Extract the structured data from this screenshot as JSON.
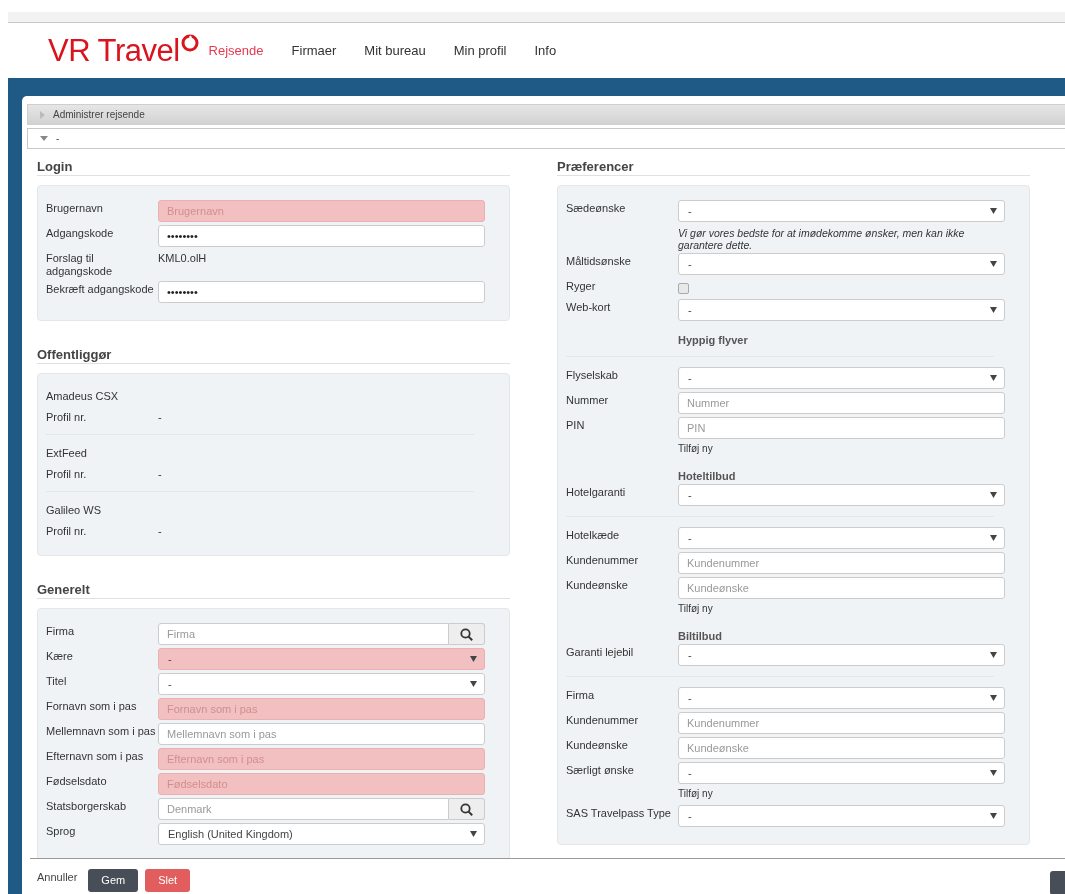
{
  "header": {
    "logo": "VR Travel",
    "nav": [
      {
        "label": "Rejsende",
        "selected": true
      },
      {
        "label": "Firmaer",
        "selected": false
      },
      {
        "label": "Mit bureau",
        "selected": false
      },
      {
        "label": "Min profil",
        "selected": false
      },
      {
        "label": "Info",
        "selected": false
      }
    ]
  },
  "panels": [
    {
      "label": "Administrer rejsende",
      "expanded": false
    },
    {
      "label": "-",
      "expanded": true
    }
  ],
  "columns": [
    [
      {
        "title": "Login",
        "rows": [
          {
            "kind": "input",
            "label": "Brugernavn",
            "placeholder": "Brugernavn",
            "invalid": true
          },
          {
            "kind": "input",
            "label": "Adgangskode",
            "value": "••••••••",
            "invalid": false
          },
          {
            "kind": "text",
            "label": "Forslag til adgangskode",
            "value": "KML0.olH"
          },
          {
            "kind": "input",
            "label": "Bekræft adgangskode",
            "value": "••••••••",
            "invalid": false
          }
        ]
      },
      {
        "title": "Offentliggør",
        "rows": [
          {
            "kind": "name",
            "label": "Amadeus CSX"
          },
          {
            "kind": "text",
            "label": "Profil nr.",
            "value": "-"
          },
          {
            "kind": "divider"
          },
          {
            "kind": "name",
            "label": "ExtFeed"
          },
          {
            "kind": "text",
            "label": "Profil nr.",
            "value": "-"
          },
          {
            "kind": "divider"
          },
          {
            "kind": "name",
            "label": "Galileo WS"
          },
          {
            "kind": "text",
            "label": "Profil nr.",
            "value": "-"
          }
        ]
      },
      {
        "title": "Generelt",
        "rows": [
          {
            "kind": "search",
            "label": "Firma",
            "placeholder": "Firma",
            "invalid": false
          },
          {
            "kind": "select",
            "label": "Kære",
            "value": "-",
            "invalid": true
          },
          {
            "kind": "select",
            "label": "Titel",
            "value": "-",
            "invalid": false
          },
          {
            "kind": "input",
            "label": "Fornavn som i pas",
            "placeholder": "Fornavn som i pas",
            "invalid": true
          },
          {
            "kind": "input",
            "label": "Mellemnavn som i pas",
            "placeholder": "Mellemnavn som i pas",
            "invalid": false
          },
          {
            "kind": "input",
            "label": "Efternavn som i pas",
            "placeholder": "Efternavn som i pas",
            "invalid": true
          },
          {
            "kind": "input",
            "label": "Fødselsdato",
            "placeholder": "Fødselsdato",
            "invalid": true
          },
          {
            "kind": "search",
            "label": "Statsborgerskab",
            "placeholder": "Denmark",
            "invalid": false
          },
          {
            "kind": "select",
            "label": "Sprog",
            "value": "English (United Kingdom)",
            "invalid": false
          }
        ]
      }
    ],
    [
      {
        "title": "Præferencer",
        "rows": [
          {
            "kind": "select",
            "label": "Sædeønske",
            "value": "-",
            "invalid": false
          },
          {
            "kind": "note",
            "value": "Vi gør vores bedste for at imødekomme ønsker, men kan ikke garantere dette."
          },
          {
            "kind": "select",
            "label": "Måltidsønske",
            "value": "-",
            "invalid": false
          },
          {
            "kind": "checkbox",
            "label": "Ryger",
            "checked": false
          },
          {
            "kind": "select",
            "label": "Web-kort",
            "value": "-",
            "invalid": false
          },
          {
            "kind": "heading",
            "value": "Hyppig flyver"
          },
          {
            "kind": "divider"
          },
          {
            "kind": "select",
            "label": "Flyselskab",
            "value": "-",
            "invalid": false
          },
          {
            "kind": "input",
            "label": "Nummer",
            "placeholder": "Nummer",
            "invalid": false
          },
          {
            "kind": "input",
            "label": "PIN",
            "placeholder": "PIN",
            "invalid": false
          },
          {
            "kind": "link",
            "value": "Tilføj ny"
          },
          {
            "kind": "heading",
            "value": "Hoteltilbud"
          },
          {
            "kind": "select",
            "label": "Hotelgaranti",
            "value": "-",
            "invalid": false
          },
          {
            "kind": "divider"
          },
          {
            "kind": "select",
            "label": "Hotelkæde",
            "value": "-",
            "invalid": false
          },
          {
            "kind": "input",
            "label": "Kundenummer",
            "placeholder": "Kundenummer",
            "invalid": false
          },
          {
            "kind": "input",
            "label": "Kundeønske",
            "placeholder": "Kundeønske",
            "invalid": false
          },
          {
            "kind": "link",
            "value": "Tilføj ny"
          },
          {
            "kind": "heading",
            "value": "Biltilbud"
          },
          {
            "kind": "select",
            "label": "Garanti lejebil",
            "value": "-",
            "invalid": false
          },
          {
            "kind": "divider"
          },
          {
            "kind": "select",
            "label": "Firma",
            "value": "-",
            "invalid": false
          },
          {
            "kind": "input",
            "label": "Kundenummer",
            "placeholder": "Kundenummer",
            "invalid": false
          },
          {
            "kind": "input",
            "label": "Kundeønske",
            "placeholder": "Kundeønske",
            "invalid": false
          },
          {
            "kind": "select",
            "label": "Særligt ønske",
            "value": "-",
            "invalid": false
          },
          {
            "kind": "link",
            "value": "Tilføj ny"
          },
          {
            "kind": "select",
            "label": "SAS Travelpass Type",
            "value": "-",
            "invalid": false
          }
        ]
      }
    ]
  ],
  "footer": {
    "cancel": "Annuller",
    "buttons": [
      {
        "label": "Gem",
        "kind": "primary"
      },
      {
        "label": "Slet",
        "kind": "danger"
      }
    ]
  }
}
